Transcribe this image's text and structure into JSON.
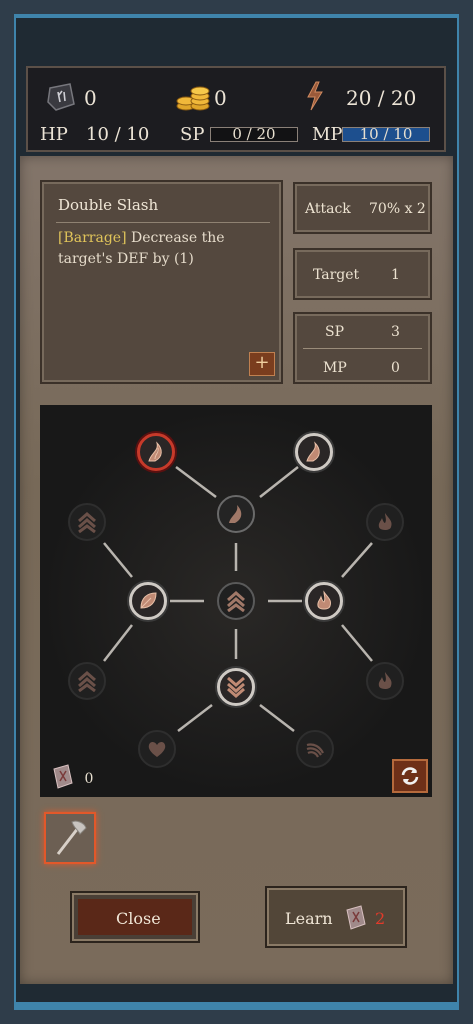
{
  "resources": {
    "runes": "0",
    "gold": "0",
    "energy": "20 / 20",
    "hp_label": "HP",
    "hp_value": "10 / 10",
    "sp_label": "SP",
    "sp_value": "0 / 20",
    "sp_fill": 0,
    "mp_label": "MP",
    "mp_value": "10 / 10",
    "mp_fill": 1
  },
  "skill": {
    "name": "Double Slash",
    "tag": "[Barrage]",
    "description": " Decrease the target's DEF by (1)",
    "attack_label": "Attack",
    "attack_value": "70% x 2",
    "target_label": "Target",
    "target_value": "1",
    "sp_label": "SP",
    "sp_value": "3",
    "mp_label": "MP",
    "mp_value": "0"
  },
  "tree": {
    "book_count": "0"
  },
  "buttons": {
    "close": "Close",
    "learn": "Learn",
    "learn_cost": "2"
  },
  "colors": {
    "selected_ring": "#c63a2a",
    "active_ring": "#cfcac4",
    "panel": "#7b6d5e"
  }
}
